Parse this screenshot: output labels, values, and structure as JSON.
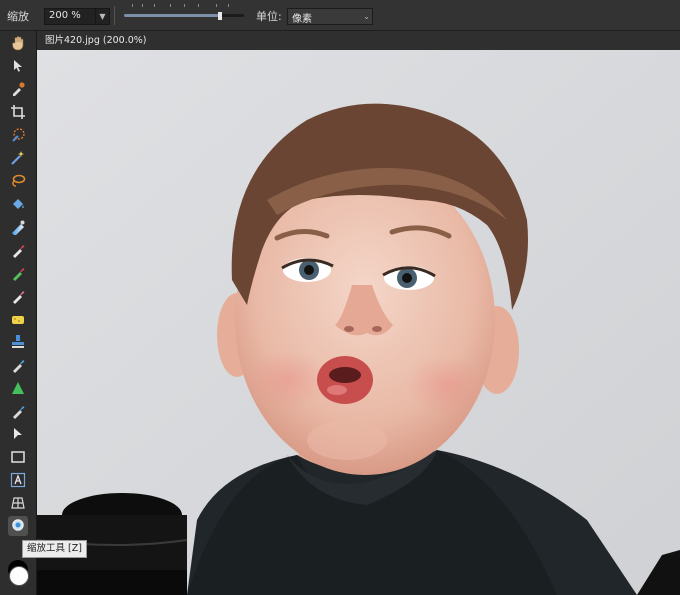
{
  "options_bar": {
    "zoom_label": "缩放",
    "zoom_value": "200 %",
    "unit_label": "单位:",
    "unit_value": "像素",
    "slider_value": 0.8
  },
  "document_tab": {
    "title": "图片420.jpg (200.0%)"
  },
  "tooltip": {
    "text": "缩放工具 [Z]"
  },
  "colors": {
    "foreground": "#ffffff",
    "background": "#000000",
    "accent": "#7d8ea8"
  },
  "tools": [
    {
      "name": "hand-tool",
      "icon": "hand-icon"
    },
    {
      "name": "move-tool",
      "icon": "arrow-cursor-icon"
    },
    {
      "name": "color-picker-tool",
      "icon": "eyedropper-icon"
    },
    {
      "name": "crop-tool",
      "icon": "crop-icon"
    },
    {
      "name": "selection-brush-tool",
      "icon": "selection-brush-icon"
    },
    {
      "name": "magic-wand-tool",
      "icon": "magic-wand-icon"
    },
    {
      "name": "lasso-tool",
      "icon": "lasso-icon"
    },
    {
      "name": "fill-tool",
      "icon": "paint-bucket-icon"
    },
    {
      "name": "gradient-tool",
      "icon": "gradient-icon"
    },
    {
      "name": "paint-brush-tool",
      "icon": "paint-brush-icon"
    },
    {
      "name": "color-replacement-tool",
      "icon": "color-replace-brush-icon"
    },
    {
      "name": "erase-brush-tool",
      "icon": "eraser-icon"
    },
    {
      "name": "sponge-tool",
      "icon": "sponge-icon"
    },
    {
      "name": "clone-tool",
      "icon": "stamp-icon"
    },
    {
      "name": "healing-tool",
      "icon": "bandage-icon"
    },
    {
      "name": "sharpen-tool",
      "icon": "sharpen-icon"
    },
    {
      "name": "smudge-tool",
      "icon": "smudge-icon"
    },
    {
      "name": "node-tool",
      "icon": "node-arrow-icon"
    },
    {
      "name": "rectangle-tool",
      "icon": "rectangle-icon"
    },
    {
      "name": "artistic-text-tool",
      "icon": "text-a-icon"
    },
    {
      "name": "mesh-warp-tool",
      "icon": "mesh-warp-icon"
    },
    {
      "name": "zoom-tool",
      "icon": "magnifier-icon"
    }
  ]
}
